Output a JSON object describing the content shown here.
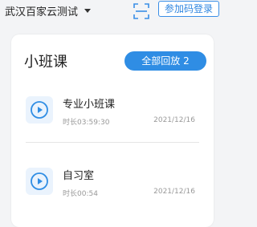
{
  "header": {
    "school_name": "武汉百家云测试",
    "join_code_label": "参加码登录"
  },
  "course": {
    "title": "小班课",
    "all_replays_label": "全部回放 2",
    "items": [
      {
        "name": "专业小班课",
        "duration": "时长03:59:30",
        "date": "2021/12/16"
      },
      {
        "name": "自习室",
        "duration": "时长00:54",
        "date": "2021/12/16"
      }
    ]
  },
  "colors": {
    "accent": "#2f8de4",
    "play_bg": "#eaf3fd",
    "page_bg": "#f3f4f6"
  },
  "icons": [
    "chevron-down-icon",
    "scan-icon",
    "play-icon"
  ]
}
